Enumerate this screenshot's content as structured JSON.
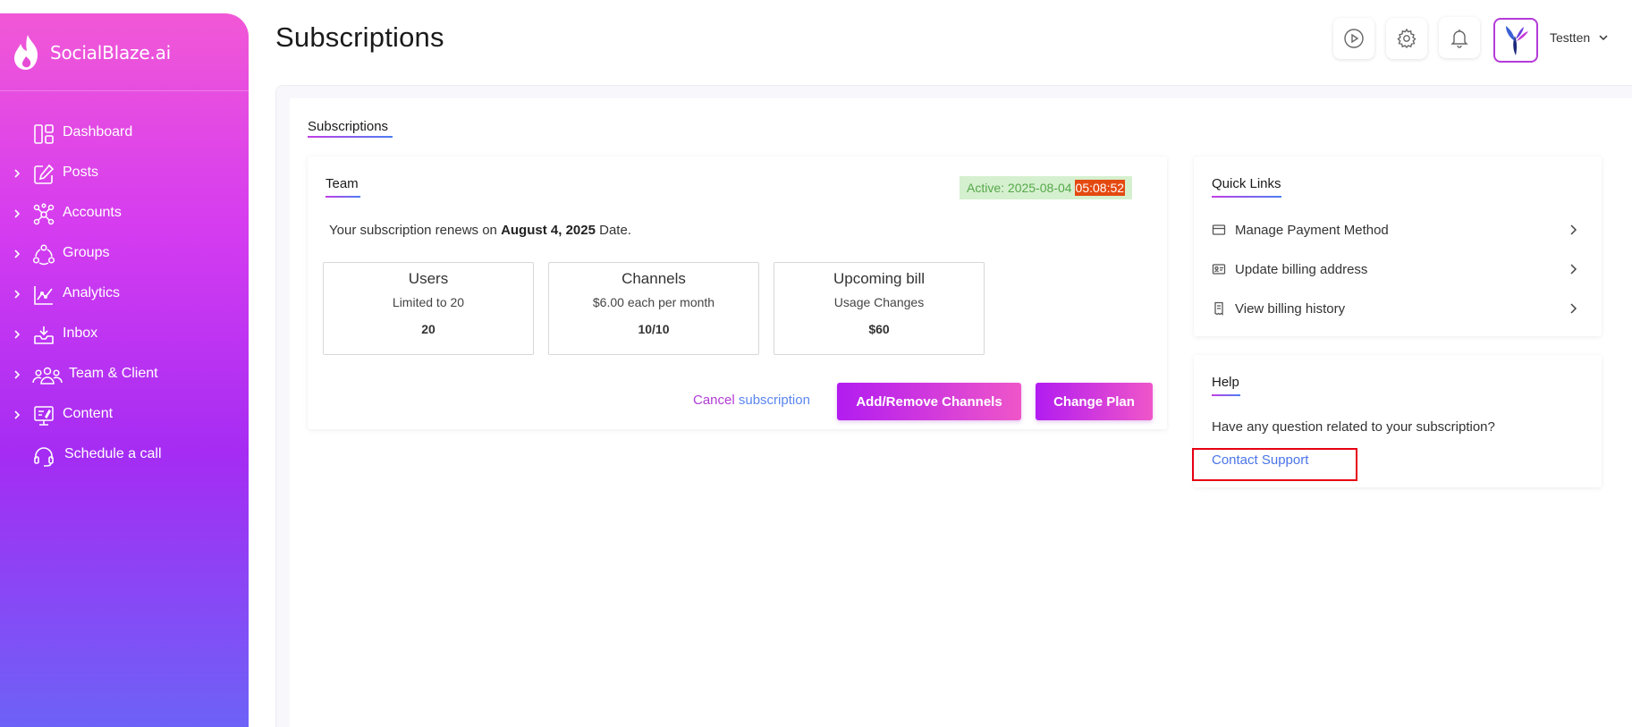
{
  "brand": {
    "name": "SocialBlaze.ai"
  },
  "sidebar": {
    "items": [
      {
        "label": "Dashboard",
        "icon": "dashboard-icon",
        "expandable": false
      },
      {
        "label": "Posts",
        "icon": "edit-icon",
        "expandable": true
      },
      {
        "label": "Accounts",
        "icon": "network-icon",
        "expandable": true
      },
      {
        "label": "Groups",
        "icon": "group-icon",
        "expandable": true
      },
      {
        "label": "Analytics",
        "icon": "analytics-icon",
        "expandable": true
      },
      {
        "label": "Inbox",
        "icon": "inbox-icon",
        "expandable": true
      },
      {
        "label": "Team & Client",
        "icon": "team-icon",
        "expandable": true
      },
      {
        "label": "Content",
        "icon": "content-icon",
        "expandable": true
      },
      {
        "label": "Schedule a call",
        "icon": "headset-icon",
        "expandable": false
      }
    ]
  },
  "header": {
    "title": "Subscriptions",
    "icons": [
      "play-icon",
      "gear-icon",
      "bell-icon"
    ],
    "user_name": "Testten"
  },
  "main": {
    "tab_label": "Subscriptions",
    "plan_card": {
      "title": "Team",
      "badge_prefix": "Active: 2025-08-04",
      "badge_time": "05:08:52",
      "renew_prefix": "Your subscription renews on",
      "renew_date": "August 4, 2025",
      "renew_suffix": "Date.",
      "stats": [
        {
          "title": "Users",
          "subtitle": "Limited to 20",
          "value": "20"
        },
        {
          "title": "Channels",
          "subtitle": "$6.00 each per month",
          "value": "10/10"
        },
        {
          "title": "Upcoming bill",
          "subtitle": "Usage Changes",
          "value": "$60"
        }
      ],
      "cancel_part1": "Cancel",
      "cancel_part2": "subscription",
      "add_remove_label": "Add/Remove Channels",
      "change_plan_label": "Change Plan"
    },
    "quick_links": {
      "title": "Quick Links",
      "items": [
        {
          "label": "Manage Payment Method",
          "icon": "credit-card-icon"
        },
        {
          "label": "Update billing address",
          "icon": "address-card-icon"
        },
        {
          "label": "View billing history",
          "icon": "receipt-icon"
        }
      ]
    },
    "help": {
      "title": "Help",
      "question": "Have any question related to your subscription?",
      "contact_label": "Contact Support"
    }
  },
  "colors": {
    "sidebar_top": "#f158d6",
    "sidebar_bottom": "#6d62f7",
    "accent_purple": "#b21cf0",
    "accent_pink": "#ef56c9",
    "link_blue": "#4a74e8",
    "badge_bg": "#d5f0cf",
    "badge_time_bg": "#e44a10",
    "highlight_red": "#e60012"
  }
}
